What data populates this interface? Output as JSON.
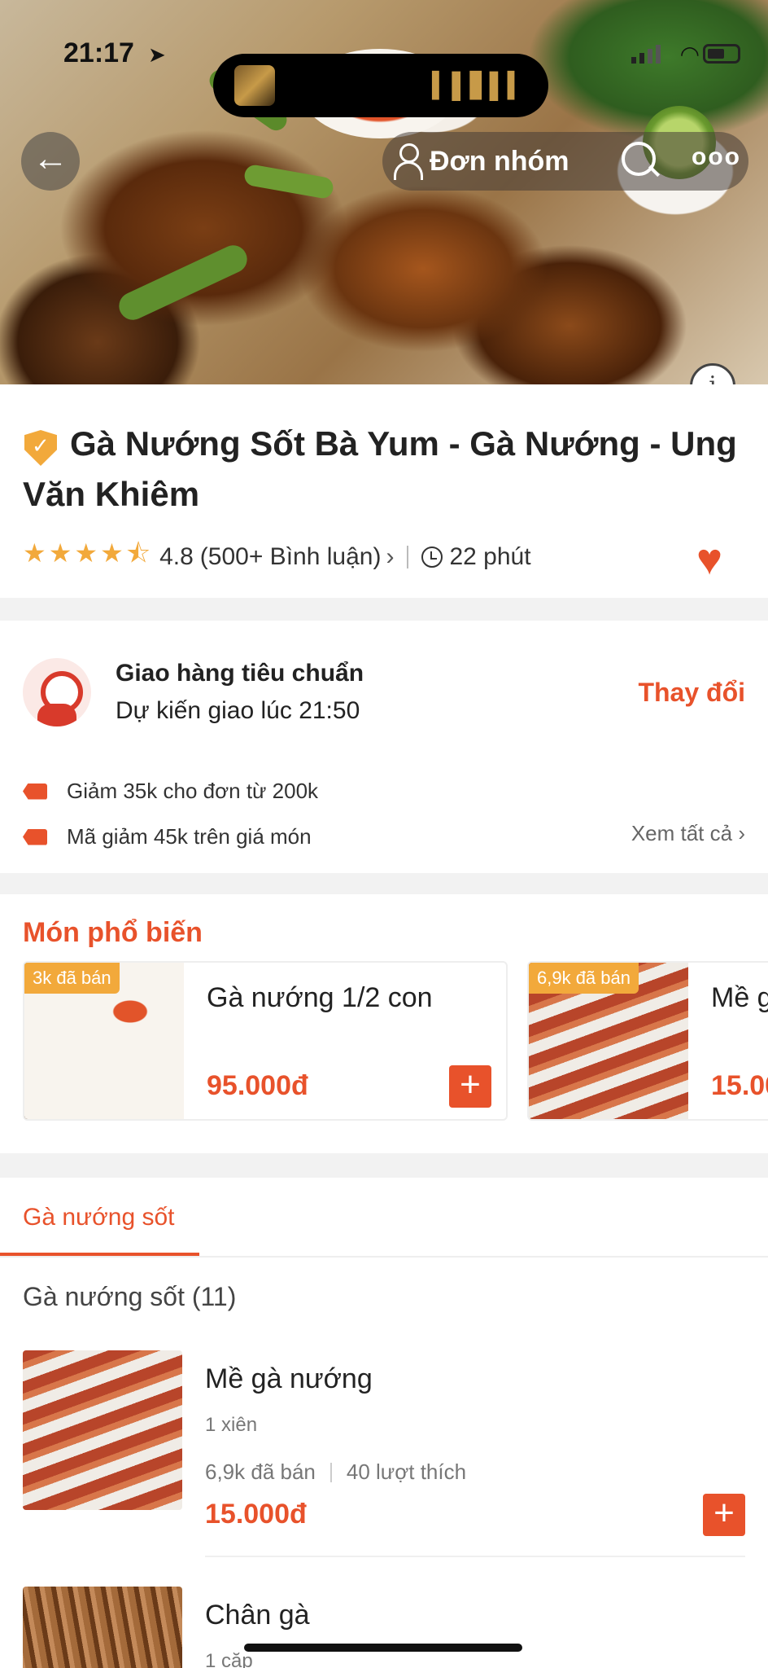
{
  "status": {
    "time": "21:17"
  },
  "header": {
    "group_order_label": "Đơn nhóm"
  },
  "restaurant": {
    "name": "Gà Nướng Sốt Bà Yum - Gà Nướng - Ung Văn Khiêm",
    "rating": "4.8",
    "reviews": "(500+ Bình luận)",
    "delivery_time": "22 phút",
    "stars": "★★★★⯪"
  },
  "delivery": {
    "title": "Giao hàng tiêu chuẩn",
    "eta": "Dự kiến giao lúc 21:50",
    "change_label": "Thay đổi",
    "promos": [
      "Giảm 35k cho đơn từ 200k",
      "Mã giảm 45k trên giá món"
    ],
    "see_all": "Xem tất cả"
  },
  "popular": {
    "heading": "Món phổ biến",
    "items": [
      {
        "badge": "3k đã bán",
        "name": "Gà nướng 1/2 con",
        "price": "95.000đ"
      },
      {
        "badge": "6,9k đã bán",
        "name": "Mề g",
        "price": "15.00"
      }
    ]
  },
  "menu": {
    "active_tab": "Gà nướng sốt",
    "section_title": "Gà nướng sốt (11)",
    "items": [
      {
        "name": "Mề gà nướng",
        "desc": "1 xiên",
        "sold": "6,9k đã bán",
        "likes": "40 lượt thích",
        "price": "15.000đ"
      },
      {
        "name": "Chân gà",
        "desc": "1 cặp"
      }
    ]
  },
  "colors": {
    "accent": "#e8522b",
    "badge": "#f2a93b"
  }
}
